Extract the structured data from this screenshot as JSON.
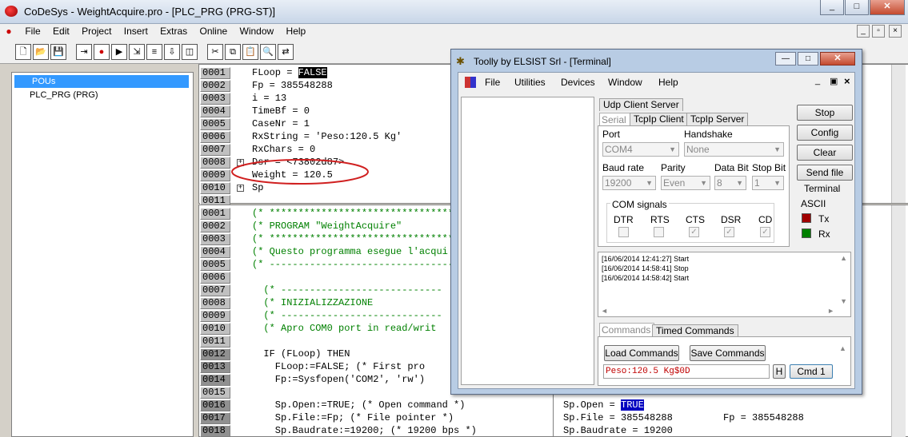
{
  "app": {
    "title": "CoDeSys - WeightAcquire.pro - [PLC_PRG (PRG-ST)]",
    "window_buttons": [
      "_",
      "□",
      "✕"
    ],
    "child_buttons": [
      "_",
      "▫",
      "×"
    ]
  },
  "menu": [
    "File",
    "Edit",
    "Project",
    "Insert",
    "Extras",
    "Online",
    "Window",
    "Help"
  ],
  "tree": {
    "root": "POUs",
    "item": "PLC_PRG (PRG)"
  },
  "upper": {
    "lines": [
      "0001",
      "0002",
      "0003",
      "0004",
      "0005",
      "0006",
      "0007",
      "0008",
      "0009",
      "0010",
      "0011"
    ],
    "code": [
      "FLoop = ",
      "Fp = 385548288",
      "i = 13",
      "TimeBf = 0",
      "CaseNr = 1",
      "RxString = 'Peso:120.5 Kg'",
      "RxChars = 0",
      "Dsr = <73802d87>",
      "Weight = 120.5",
      "Sp",
      ""
    ],
    "floop_val": "FALSE"
  },
  "lower": {
    "lines": [
      "0001",
      "0002",
      "0003",
      "0004",
      "0005",
      "0006",
      "0007",
      "0008",
      "0009",
      "0010",
      "0011",
      "0012",
      "0013",
      "0014",
      "0015",
      "0016",
      "0017",
      "0018"
    ],
    "code": [
      "(* ****************************************",
      "(* PROGRAM \"WeightAcquire\"",
      "(* ****************************************",
      "(* Questo programma esegue l'acqui",
      "(* ----------------------------------------",
      "",
      "  (* ----------------------------",
      "  (* INIZIALIZZAZIONE",
      "  (* ----------------------------",
      "  (* Apro COM0 port in read/writ",
      "",
      "  IF (FLoop) THEN",
      "    FLoop:=FALSE; (* First pro",
      "    Fp:=Sysfopen('COM2', 'rw')",
      "",
      "    Sp.Open:=TRUE; (* Open command *)",
      "    Sp.File:=Fp; (* File pointer *)",
      "    Sp.Baudrate:=19200; (* 19200 bps *)"
    ],
    "mon": {
      "open": "Sp.Open = ",
      "open_val": "TRUE",
      "file": "Sp.File = 385548288",
      "fp": "Fp = 385548288",
      "baud": "Sp.Baudrate = 19200"
    }
  },
  "toolly": {
    "title": "Toolly by ELSIST Srl - [Terminal]",
    "menu": [
      "File",
      "Utilities",
      "Devices",
      "Window",
      "Help"
    ],
    "tabs_top": [
      "Udp Client Server",
      "Serial",
      "TcpIp Client",
      "TcpIp Server"
    ],
    "port_label": "Port",
    "port": "COM4",
    "handshake_label": "Handshake",
    "handshake": "None",
    "baud_label": "Baud rate",
    "baud": "19200",
    "parity_label": "Parity",
    "parity": "Even",
    "databit_label": "Data Bit",
    "databit": "8",
    "stopbit_label": "Stop Bit",
    "stopbit": "1",
    "com_signals": "COM signals",
    "signals": [
      "DTR",
      "RTS",
      "CTS",
      "DSR",
      "CD"
    ],
    "buttons": [
      "Stop",
      "Config",
      "Clear",
      "Send file"
    ],
    "terminal": "Terminal",
    "ascii": "ASCII",
    "tx": "Tx",
    "rx": "Rx",
    "log": [
      "[16/06/2014 12:41:27] Start",
      "[16/06/2014 14:58:41] Stop",
      "[16/06/2014 14:58:42] Start"
    ],
    "tabs_bottom": [
      "Commands",
      "Timed Commands"
    ],
    "load": "Load Commands",
    "save": "Save Commands",
    "cmd_value": "Peso:120.5 Kg$0D",
    "h": "H",
    "cmd1": "Cmd 1",
    "colors": {
      "tx": "#a00000",
      "rx": "#008000"
    }
  }
}
